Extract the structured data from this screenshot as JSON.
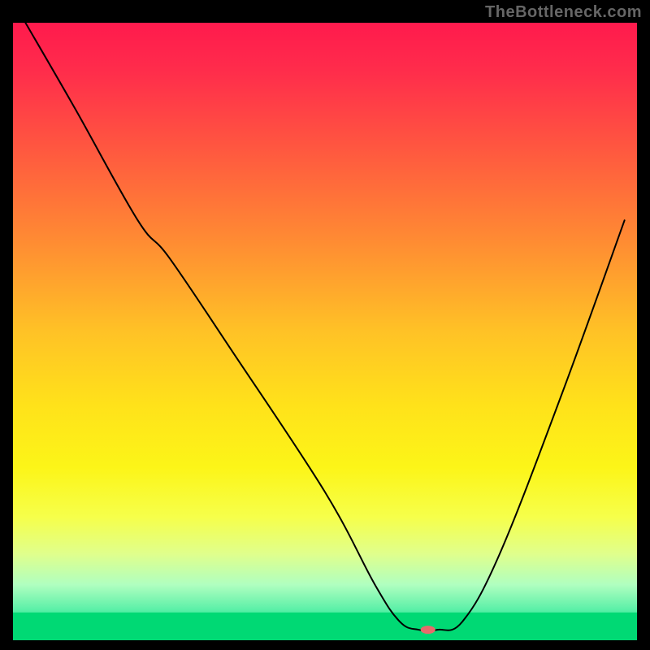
{
  "watermark": "TheBottleneck.com",
  "chart_data": {
    "type": "line",
    "title": "",
    "xlabel": "",
    "ylabel": "",
    "xlim": [
      0,
      100
    ],
    "ylim": [
      0,
      100
    ],
    "background": {
      "type": "vertical-gradient",
      "stops": [
        {
          "offset": 0,
          "color": "#ff1a4d"
        },
        {
          "offset": 0.08,
          "color": "#ff2d4b"
        },
        {
          "offset": 0.2,
          "color": "#ff5640"
        },
        {
          "offset": 0.35,
          "color": "#ff8a33"
        },
        {
          "offset": 0.5,
          "color": "#ffc226"
        },
        {
          "offset": 0.62,
          "color": "#ffe21a"
        },
        {
          "offset": 0.72,
          "color": "#fcf518"
        },
        {
          "offset": 0.8,
          "color": "#f6ff4a"
        },
        {
          "offset": 0.86,
          "color": "#e0ff8c"
        },
        {
          "offset": 0.91,
          "color": "#b0ffc0"
        },
        {
          "offset": 0.95,
          "color": "#5cf0a8"
        },
        {
          "offset": 0.975,
          "color": "#1de38a"
        },
        {
          "offset": 1.0,
          "color": "#00d974"
        }
      ]
    },
    "green_band": {
      "y_from": 94.5,
      "y_to": 100
    },
    "series": [
      {
        "name": "bottleneck-curve",
        "x": [
          2,
          10,
          20,
          25,
          35,
          50,
          58,
          62,
          65,
          68,
          72,
          78,
          88,
          98
        ],
        "y": [
          100,
          86,
          68,
          62,
          47,
          24,
          9,
          3,
          1.7,
          1.7,
          3,
          14,
          40,
          68
        ],
        "stroke": "#000000",
        "stroke_width": 2
      }
    ],
    "marker": {
      "name": "optimal-point",
      "x": 66.5,
      "y": 1.7,
      "color": "#e86b6b",
      "rx": 9,
      "ry": 5
    }
  }
}
